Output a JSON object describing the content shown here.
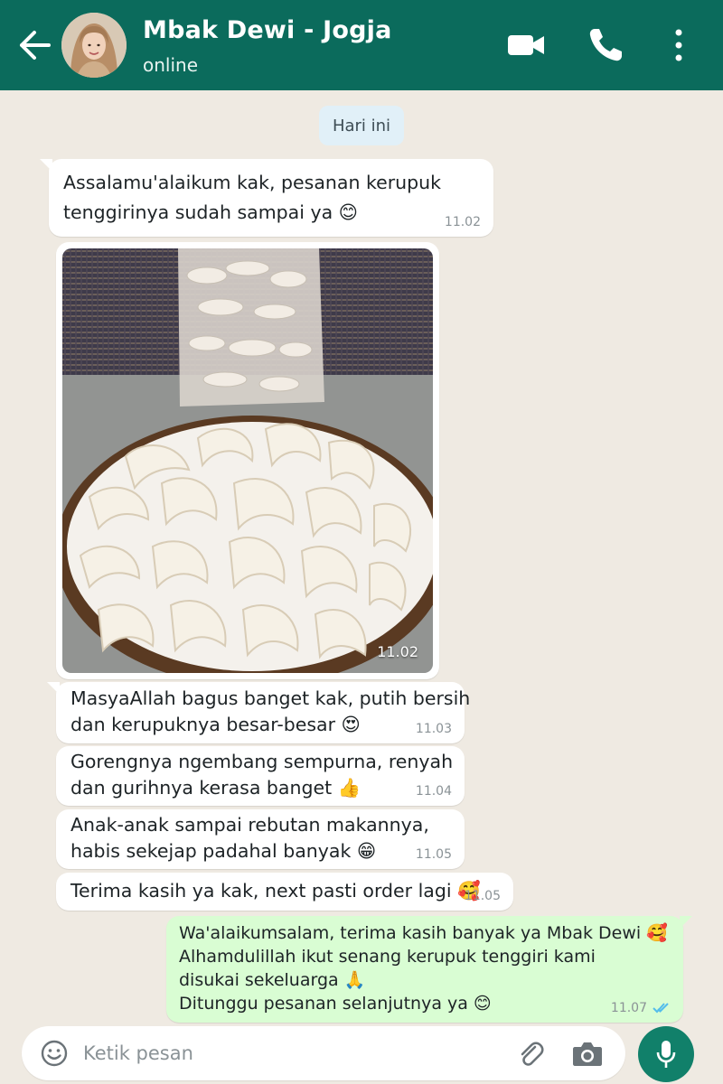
{
  "header": {
    "contact_name": "Mbak Dewi - Jogja",
    "status": "online",
    "icons": [
      "back-arrow-icon",
      "avatar",
      "video-call-icon",
      "phone-icon",
      "more-vert-icon"
    ],
    "color": "#0b6b5c"
  },
  "chat": {
    "date_label": "Hari ini",
    "messages": [
      {
        "direction": "incoming",
        "lines": [
          "Assalamu'alaikum kak, pesanan kerupuk",
          "tenggirinya sudah sampai ya 😊"
        ],
        "time": "11.02"
      },
      {
        "direction": "incoming",
        "type": "image",
        "image_content": "kerupuk-tenggiri-in-basket-photo",
        "time": "11.02"
      },
      {
        "direction": "incoming",
        "lines": [
          "MasyaAllah bagus banget kak, putih bersih",
          "dan kerupuknya besar-besar 😍"
        ],
        "time": "11.03"
      },
      {
        "direction": "incoming",
        "lines": [
          "Gorengnya ngembang sempurna, renyah",
          "dan gurihnya kerasa banget 👍"
        ],
        "time": "11.04"
      },
      {
        "direction": "incoming",
        "lines": [
          "Anak-anak sampai rebutan makannya,",
          "habis sekejap padahal banyak 😁"
        ],
        "time": "11.05"
      },
      {
        "direction": "incoming",
        "lines": [
          "Terima kasih ya kak, next pasti order lagi 🥰"
        ],
        "time": "11.05"
      },
      {
        "direction": "outgoing",
        "lines": [
          "Wa'alaikumsalam, terima kasih banyak ya Mbak Dewi 🥰",
          "Alhamdulillah ikut senang kerupuk tenggiri kami",
          "disukai sekeluarga 🙏",
          "Ditunggu pesanan selanjutnya ya 😊"
        ],
        "time": "11.07",
        "status": "read"
      }
    ]
  },
  "composer": {
    "placeholder": "Ketik pesan",
    "icons": [
      "emoji-icon",
      "attach-icon",
      "camera-icon",
      "mic-icon"
    ]
  },
  "colors": {
    "background": "#efeae2",
    "incoming_bubble": "#ffffff",
    "outgoing_bubble": "#d9fdd3",
    "read_receipt": "#53bdeb",
    "mic_button": "#11806a"
  }
}
